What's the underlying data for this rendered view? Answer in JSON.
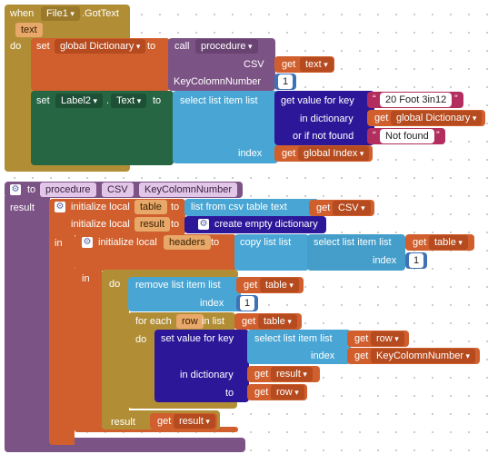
{
  "event": {
    "when": "when",
    "component": "File1",
    "event_name": ".GotText",
    "param": "text",
    "do": "do"
  },
  "set_dict": {
    "set": "set",
    "var": "global Dictionary",
    "to": "to",
    "call": "call",
    "proc": "procedure",
    "arg1_label": "CSV",
    "arg2_label": "KeyColomnNumber",
    "get_text": "text",
    "num": "1"
  },
  "set_label": {
    "set": "set",
    "component": "Label2",
    "dot": ".",
    "prop": "Text",
    "to": "to",
    "select": "select list item  list",
    "index": "index",
    "get_global_index": "global Index",
    "gvfk": "get value for key",
    "key_string": "20 Foot 3in12",
    "in_dict": "in dictionary",
    "get_global_dict": "global Dictionary",
    "if_not_found": "or if not found",
    "nf_string": "Not found"
  },
  "proc_def": {
    "to": "to",
    "proc": "procedure",
    "param1": "CSV",
    "param2": "KeyColomnNumber",
    "result": "result"
  },
  "locals": {
    "init_local": "initialize local",
    "table": "table",
    "to": "to",
    "csv_to_list": "list from csv table  text",
    "get_csv": "CSV",
    "result_var": "result",
    "create_dict": "create empty dictionary",
    "in": "in",
    "headers": "headers",
    "copy_list": "copy list  list",
    "select_list": "select list item  list",
    "get_table": "table",
    "index": "index",
    "num1": "1"
  },
  "inner": {
    "in": "in",
    "do": "do",
    "remove_item": "remove list item  list",
    "get_table": "table",
    "index": "index",
    "num1": "1",
    "for_each": "for each",
    "row": "row",
    "in_list": "in list",
    "get_table2": "table",
    "do2": "do",
    "set_value": "set value for key",
    "select_list": "select list item  list",
    "get_row": "row",
    "index2": "index",
    "get_keycol": "KeyColomnNumber",
    "in_dictionary": "in dictionary",
    "get_result": "result",
    "to": "to",
    "get_row2": "row",
    "result_label": "result",
    "get_result2": "result"
  },
  "common": {
    "get": "get"
  },
  "colors": {
    "event": "#b18e35",
    "variable": "#d05f2d",
    "component": "#266643",
    "procedure": "#7c5385",
    "list": "#49a6d4",
    "text": "#b32d5e",
    "math": "#3f71b5",
    "dictionary": "#2d1799"
  }
}
